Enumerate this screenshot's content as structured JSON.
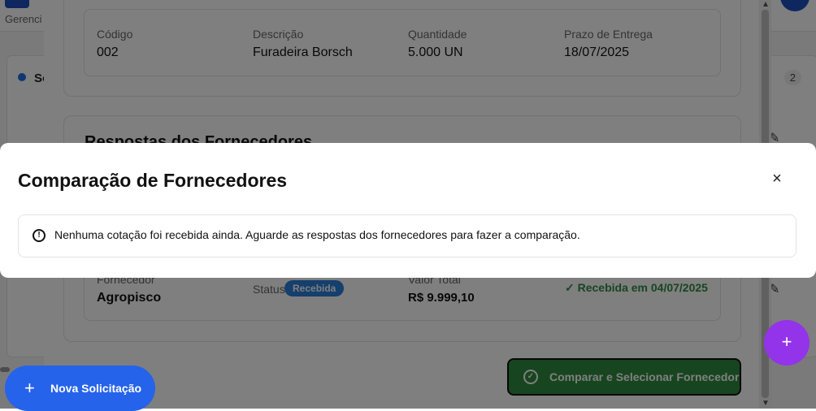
{
  "background": {
    "subtitle": "Gerenci",
    "section_title": "So",
    "section_count": "2"
  },
  "panel": {
    "item": {
      "labels": {
        "code": "Código",
        "description": "Descrição",
        "quantity": "Quantidade",
        "deadline": "Prazo de Entrega"
      },
      "values": {
        "code": "002",
        "description": "Furadeira Borsch",
        "quantity": "5.000 UN",
        "deadline": "18/07/2025"
      }
    },
    "quotes_section_title": "Respostas dos Fornecedores",
    "quote": {
      "supplier_label": "Fornecedor",
      "supplier_value": "Agropisco",
      "status_label": "Status",
      "status_badge": "Recebida",
      "total_label": "Valor Total",
      "total_value": "R$ 9.999,10",
      "received_text": "✓ Recebida em 04/07/2025"
    },
    "compare_button_label": "Comparar e Selecionar Fornecedor"
  },
  "modal": {
    "title": "Comparação de Fornecedores",
    "close_icon": "×",
    "alert_icon": "!",
    "alert_text": "Nenhuma cotação foi recebida ainda. Aguarde as respostas dos fornecedores para fazer a comparação."
  },
  "fab": {
    "new_request_label": "Nova Solicitação",
    "plus_icon": "+"
  },
  "colors": {
    "primary_blue": "#2563eb",
    "success_green": "#2e8b3e",
    "purple": "#9333ea",
    "badge_blue": "#2b7fd8"
  }
}
